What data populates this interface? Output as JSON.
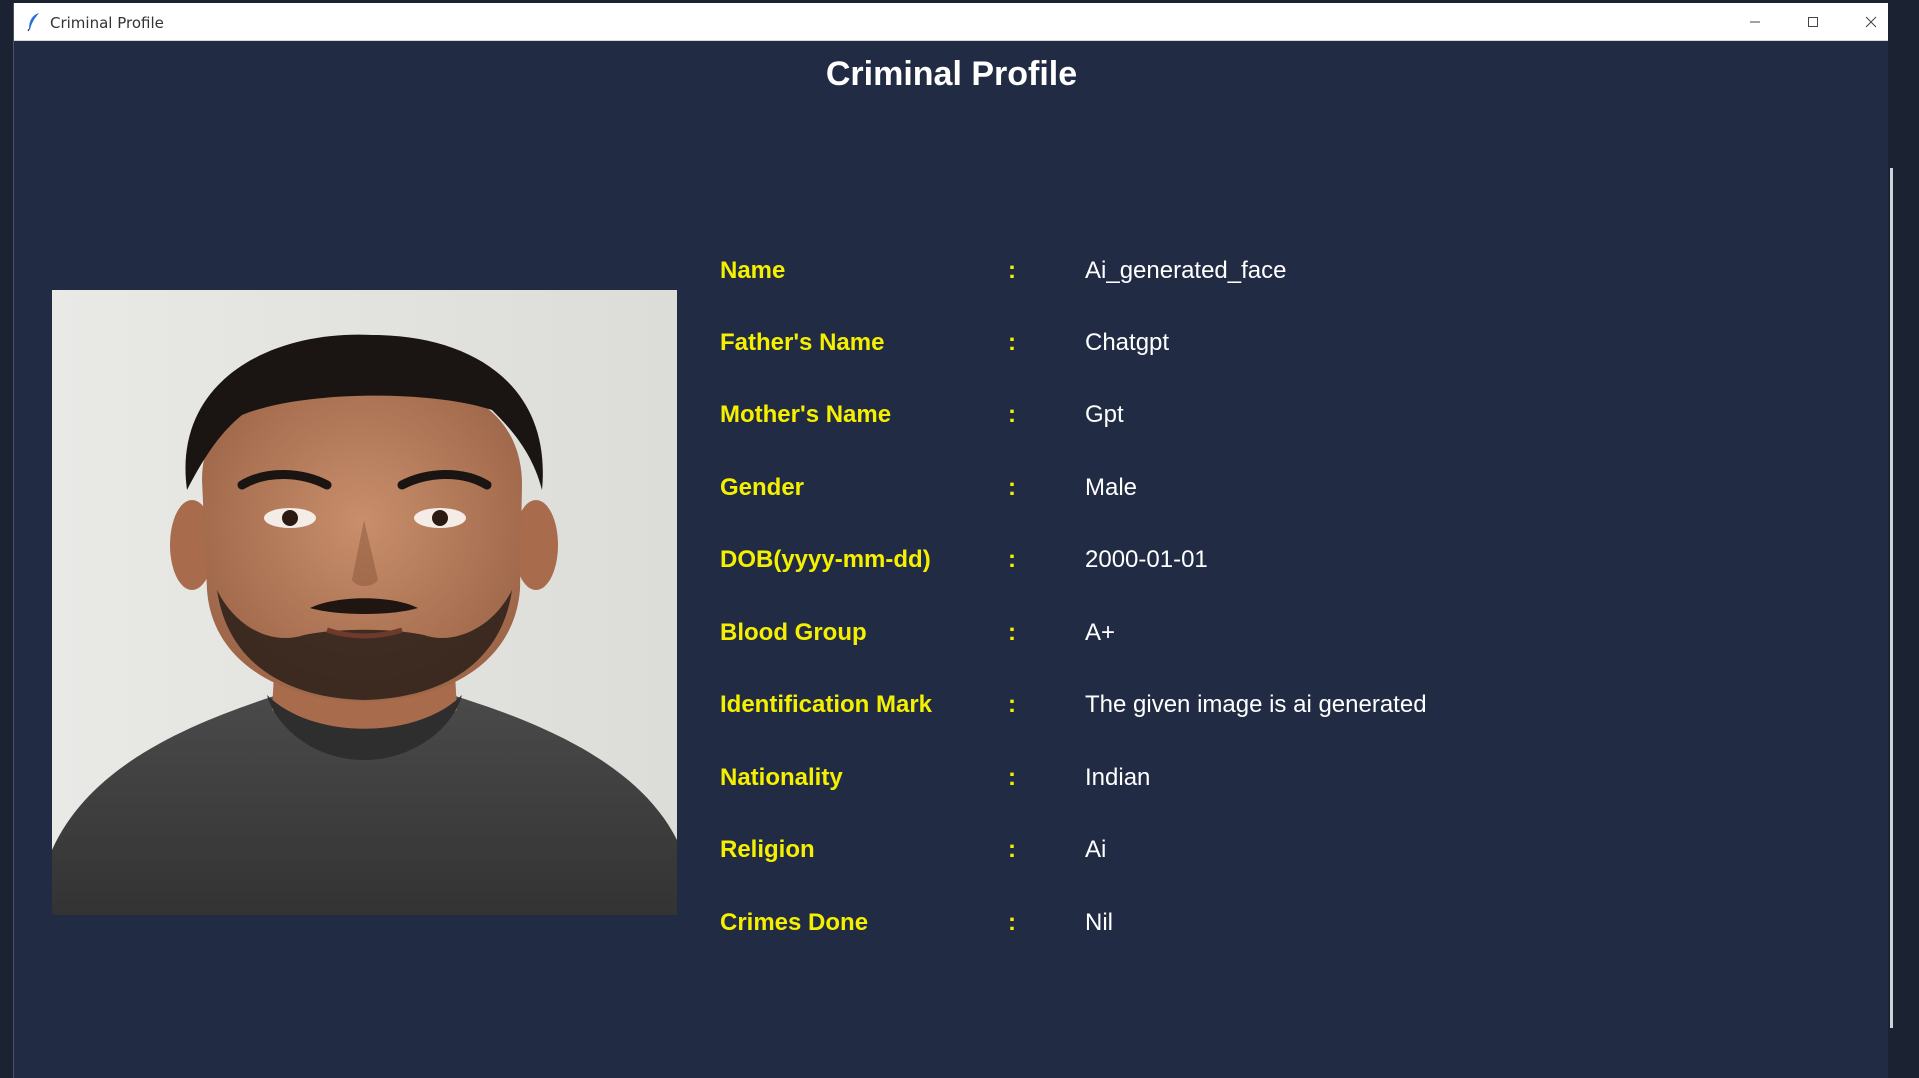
{
  "window": {
    "title": "Criminal Profile",
    "controls": [
      "minimize",
      "maximize",
      "close"
    ]
  },
  "page": {
    "heading": "Criminal Profile"
  },
  "profile": {
    "photo_alt": "Ai generated face photo",
    "fields": [
      {
        "label": "Name",
        "value": "Ai_generated_face"
      },
      {
        "label": "Father's Name",
        "value": "Chatgpt"
      },
      {
        "label": "Mother's Name",
        "value": "Gpt"
      },
      {
        "label": "Gender",
        "value": "Male"
      },
      {
        "label": "DOB(yyyy-mm-dd)",
        "value": "2000-01-01"
      },
      {
        "label": "Blood Group",
        "value": "A+"
      },
      {
        "label": "Identification Mark",
        "value": "The given image is ai generated"
      },
      {
        "label": "Nationality",
        "value": "Indian"
      },
      {
        "label": "Religion",
        "value": "Ai"
      },
      {
        "label": "Crimes Done",
        "value": "Nil"
      }
    ],
    "separator": ":"
  },
  "colors": {
    "background": "#212c44",
    "label": "#f5f000",
    "value": "#ffffff",
    "heading": "#ffffff"
  }
}
